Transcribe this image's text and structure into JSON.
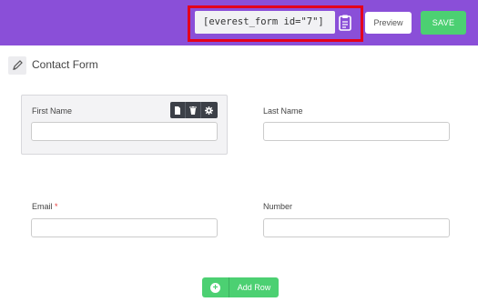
{
  "topbar": {
    "shortcode": "[everest_form id=\"7\"]",
    "preview_label": "Preview",
    "save_label": "SAVE"
  },
  "form": {
    "title": "Contact Form",
    "fields": [
      {
        "label": "First Name",
        "required": false,
        "value": ""
      },
      {
        "label": "Last Name",
        "required": false,
        "value": ""
      },
      {
        "label": "Email",
        "required": true,
        "required_mark": "*",
        "value": ""
      },
      {
        "label": "Number",
        "required": false,
        "value": ""
      }
    ],
    "add_row_label": "Add Row"
  },
  "colors": {
    "topbar": "#8a4fd8",
    "save": "#4cd072",
    "highlight": "#e4001b"
  }
}
